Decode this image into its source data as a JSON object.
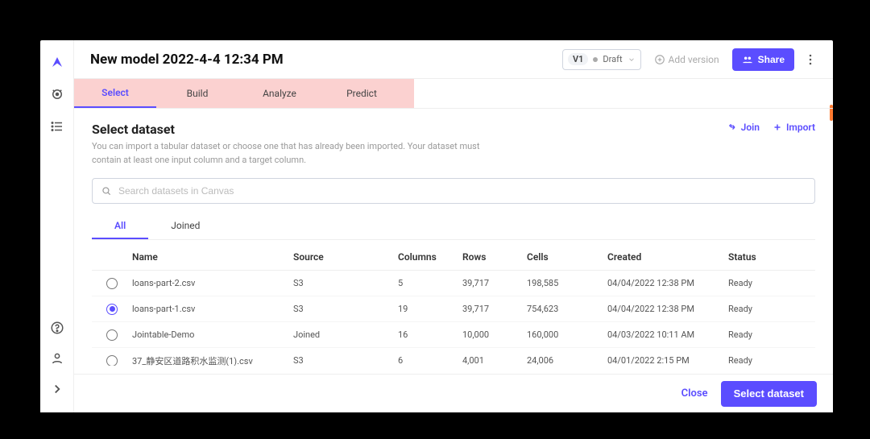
{
  "header": {
    "title": "New model 2022-4-4 12:34 PM",
    "version_badge": "V1",
    "version_status": "Draft",
    "add_version_label": "Add version",
    "share_label": "Share"
  },
  "tabs": [
    "Select",
    "Build",
    "Analyze",
    "Predict"
  ],
  "active_tab": 0,
  "section": {
    "title": "Select dataset",
    "subtitle": "You can import a tabular dataset or choose one that has already been imported. Your dataset must contain at least one input column and a target column.",
    "join_label": "Join",
    "import_label": "Import"
  },
  "search": {
    "placeholder": "Search datasets in Canvas"
  },
  "subtabs": [
    "All",
    "Joined"
  ],
  "active_subtab": 0,
  "table": {
    "columns": [
      "Name",
      "Source",
      "Columns",
      "Rows",
      "Cells",
      "Created",
      "Status"
    ],
    "rows": [
      {
        "name": "loans-part-2.csv",
        "source": "S3",
        "columns": "5",
        "rows": "39,717",
        "cells": "198,585",
        "created": "04/04/2022 12:38 PM",
        "status": "Ready",
        "selected": false
      },
      {
        "name": "loans-part-1.csv",
        "source": "S3",
        "columns": "19",
        "rows": "39,717",
        "cells": "754,623",
        "created": "04/04/2022 12:38 PM",
        "status": "Ready",
        "selected": true
      },
      {
        "name": "Jointable-Demo",
        "source": "Joined",
        "columns": "16",
        "rows": "10,000",
        "cells": "160,000",
        "created": "04/03/2022 10:11 AM",
        "status": "Ready",
        "selected": false
      },
      {
        "name": "37_静安区道路积水监测(1).csv",
        "source": "S3",
        "columns": "6",
        "rows": "4,001",
        "cells": "24,006",
        "created": "04/01/2022 2:15 PM",
        "status": "Ready",
        "selected": false
      }
    ]
  },
  "footer": {
    "close_label": "Close",
    "select_label": "Select dataset"
  }
}
